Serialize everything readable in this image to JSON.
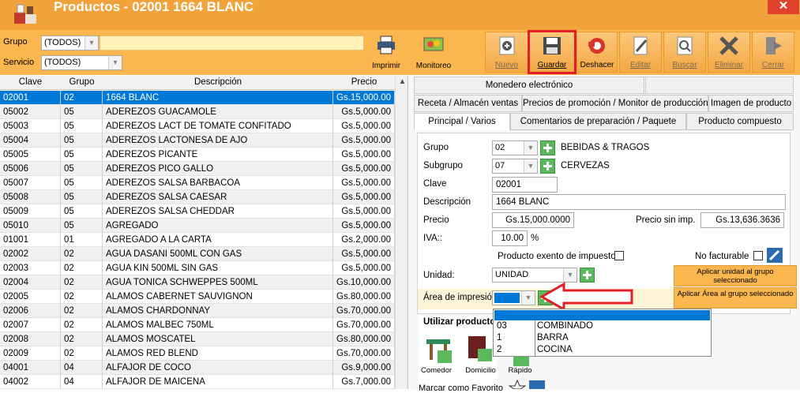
{
  "window": {
    "title": "Productos - 02001   1664 BLANC",
    "close_label": "✕"
  },
  "filters": {
    "grupo_label": "Grupo",
    "grupo_value": "(TODOS)",
    "servicio_label": "Servicio",
    "servicio_value": "(TODOS)"
  },
  "toolbar": {
    "imprimir": "Imprimir",
    "monitoreo": "Monitoreo",
    "nuevo": "Nuevo",
    "guardar": "Guardar",
    "deshacer": "Deshacer",
    "editar": "Editar",
    "buscar": "Buscar",
    "eliminar": "Eliminar",
    "cerrar": "Cerrar"
  },
  "grid": {
    "columns": [
      "Clave",
      "Grupo",
      "Descripción",
      "Precio"
    ],
    "rows": [
      [
        "02001",
        "02",
        "1664 BLANC",
        "Gs.15,000.00"
      ],
      [
        "05002",
        "05",
        "ADEREZOS GUACAMOLE",
        "Gs.5,000.00"
      ],
      [
        "05003",
        "05",
        "ADEREZOS LACT DE TOMATE CONFITADO",
        "Gs.5,000.00"
      ],
      [
        "05004",
        "05",
        "ADEREZOS LACTONESA DE AJO",
        "Gs.5,000.00"
      ],
      [
        "05005",
        "05",
        "ADEREZOS PICANTE",
        "Gs.5,000.00"
      ],
      [
        "05006",
        "05",
        "ADEREZOS PICO GALLO",
        "Gs.5,000.00"
      ],
      [
        "05007",
        "05",
        "ADEREZOS SALSA BARBACOA",
        "Gs.5,000.00"
      ],
      [
        "05008",
        "05",
        "ADEREZOS SALSA CAESAR",
        "Gs.5,000.00"
      ],
      [
        "05009",
        "05",
        "ADEREZOS SALSA CHEDDAR",
        "Gs.5,000.00"
      ],
      [
        "05010",
        "05",
        "AGREGADO",
        "Gs.5,000.00"
      ],
      [
        "01001",
        "01",
        "AGREGADO A LA CARTA",
        "Gs.2,000.00"
      ],
      [
        "02002",
        "02",
        "AGUA DASANI 500ML CON GAS",
        "Gs.5,000.00"
      ],
      [
        "02003",
        "02",
        "AGUA KIN 500ML SIN GAS",
        "Gs.5,000.00"
      ],
      [
        "02004",
        "02",
        "AGUA TONICA SCHWEPPES 500ML",
        "Gs.10,000.00"
      ],
      [
        "02005",
        "02",
        "ALAMOS CABERNET SAUVIGNON",
        "Gs.80,000.00"
      ],
      [
        "02006",
        "02",
        "ALAMOS CHARDONNAY",
        "Gs.70,000.00"
      ],
      [
        "02007",
        "02",
        "ALAMOS MALBEC 750ML",
        "Gs.70,000.00"
      ],
      [
        "02008",
        "02",
        "ALAMOS MOSCATEL",
        "Gs.80,000.00"
      ],
      [
        "02009",
        "02",
        "ALAMOS RED BLEND",
        "Gs.70,000.00"
      ],
      [
        "04001",
        "04",
        "ALFAJOR DE COCO",
        "Gs.9,000.00"
      ],
      [
        "04002",
        "04",
        "ALFAJOR DE MAICENA",
        "Gs.7,000.00"
      ]
    ]
  },
  "tabs": {
    "monedero": "Monedero electrónico",
    "receta": "Receta / Almacén ventas",
    "precios_promo": "Precios de promoción / Monitor de producción",
    "imagen": "Imagen de producto",
    "principal": "Principal / Varios",
    "comentarios": "Comentarios de preparación / Paquete",
    "compuesto": "Producto compuesto"
  },
  "form": {
    "grupo_label": "Grupo",
    "grupo_value": "02",
    "grupo_name": "BEBIDAS & TRAGOS",
    "subgrupo_label": "Subgrupo",
    "subgrupo_value": "07",
    "subgrupo_name": "CERVEZAS",
    "clave_label": "Clave",
    "clave_value": "02001",
    "descripcion_label": "Descripción",
    "descripcion_value": "1664 BLANC",
    "precio_label": "Precio",
    "precio_value": "Gs.15,000.0000",
    "precio_sin_imp_label": "Precio sin imp.",
    "precio_sin_imp_value": "Gs.13,636.3636",
    "iva_label": "IVA::",
    "iva_value": "10.00",
    "iva_unit": "%",
    "exento_label": "Producto exento de impuestos",
    "no_facturable_label": "No facturable",
    "unidad_label": "Unidad:",
    "unidad_value": "UNIDAD",
    "aplicar_unidad": "Aplicar unidad al grupo seleccionado",
    "area_label": "Área de impresión:",
    "aplicar_area": "Aplicar Área al grupo seleccionado"
  },
  "dropdown": {
    "items": [
      {
        "code": "03",
        "name": "COMBINADO"
      },
      {
        "code": "1",
        "name": "BARRA"
      },
      {
        "code": "2",
        "name": "COCINA"
      }
    ]
  },
  "utilizar": {
    "label": "Utilizar producto",
    "comedor": "Comedor",
    "domicilio": "Domicilio",
    "rapido": "Rápido",
    "favorito": "Marcar como Favorito"
  },
  "colors": {
    "accent": "#f2a23a",
    "selection": "#0078d7",
    "highlight": "#e21f26"
  }
}
